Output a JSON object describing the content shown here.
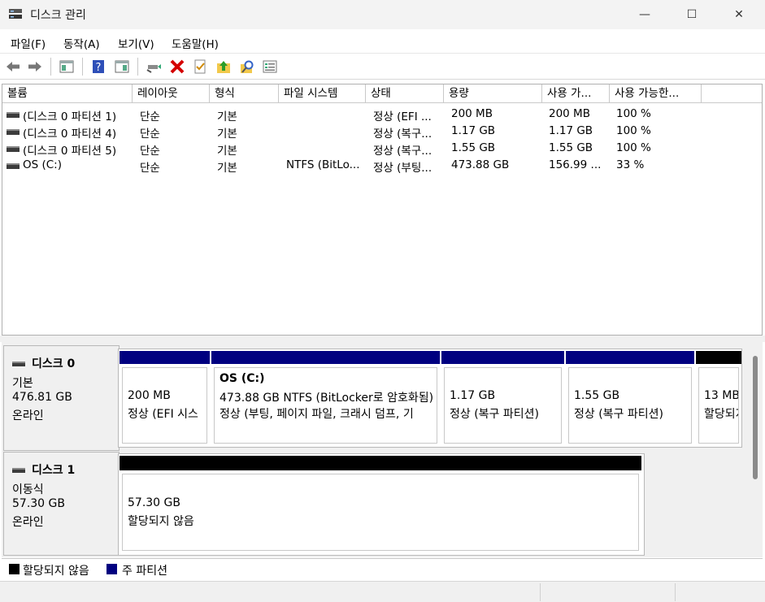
{
  "window": {
    "title": "디스크 관리",
    "minimize_glyph": "—",
    "maximize_glyph": "☐",
    "close_glyph": "✕"
  },
  "menu": [
    "파일(F)",
    "동작(A)",
    "보기(V)",
    "도움말(H)"
  ],
  "toolbar": {
    "icons": [
      "back-icon",
      "forward-icon",
      "show-hide-console-tree-icon",
      "help-icon",
      "show-action-pane-icon",
      "connect-icon",
      "delete-icon",
      "check-icon",
      "up-folder-icon",
      "search-icon",
      "properties-icon"
    ],
    "delete_color": "#d40000"
  },
  "volume_table": {
    "columns": [
      "볼륨",
      "레이아웃",
      "형식",
      "파일 시스템",
      "상태",
      "용량",
      "사용 가...",
      "사용 가능한..."
    ],
    "rows": [
      [
        "(디스크 0 파티션 1)",
        "단순",
        "기본",
        "",
        "정상 (EFI ...",
        "200 MB",
        "200 MB",
        "100 %"
      ],
      [
        "(디스크 0 파티션 4)",
        "단순",
        "기본",
        "",
        "정상 (복구...",
        "1.17 GB",
        "1.17 GB",
        "100 %"
      ],
      [
        "(디스크 0 파티션 5)",
        "단순",
        "기본",
        "",
        "정상 (복구...",
        "1.55 GB",
        "1.55 GB",
        "100 %"
      ],
      [
        "OS (C:)",
        "단순",
        "기본",
        "NTFS (BitLo...",
        "정상 (부팅...",
        "473.88 GB",
        "156.99 ...",
        "33 %"
      ]
    ]
  },
  "disks": [
    {
      "name": "디스크 0",
      "type": "기본",
      "size": "476.81 GB",
      "state": "온라인",
      "partitions": [
        {
          "title": "",
          "line1": "200 MB",
          "line2": "정상 (EFI 시스",
          "bar": "primary"
        },
        {
          "title": "OS  (C:)",
          "line1": "473.88 GB NTFS (BitLocker로 암호화됨)",
          "line2": "정상 (부팅, 페이지 파일, 크래시 덤프, 기",
          "bar": "primary"
        },
        {
          "title": "",
          "line1": "1.17 GB",
          "line2": "정상 (복구 파티션)",
          "bar": "primary"
        },
        {
          "title": "",
          "line1": "1.55 GB",
          "line2": "정상 (복구 파티션)",
          "bar": "primary"
        },
        {
          "title": "",
          "line1": "13 MB",
          "line2": "할당되지 않음",
          "bar": "unallocated"
        }
      ]
    },
    {
      "name": "디스크 1",
      "type": "이동식",
      "size": "57.30 GB",
      "state": "온라인",
      "partitions": [
        {
          "title": "",
          "line1": "57.30 GB",
          "line2": "할당되지 않음",
          "bar": "unallocated"
        }
      ]
    }
  ],
  "legend": [
    {
      "label": "할당되지 않음",
      "color": "#000000"
    },
    {
      "label": "주 파티션",
      "color": "#000080"
    }
  ],
  "colors": {
    "primary": "#000080",
    "unallocated": "#000000"
  }
}
